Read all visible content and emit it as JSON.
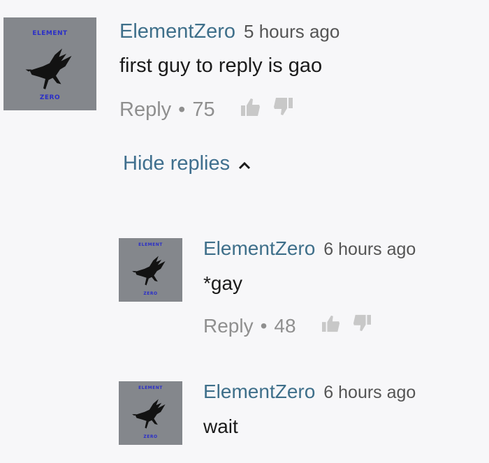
{
  "comment": {
    "avatar": {
      "top_text": "ELEMENT",
      "bottom_text": "ZERO",
      "icon": "crow-icon"
    },
    "author": "ElementZero",
    "time": "5 hours ago",
    "text": "first guy to reply is gao",
    "reply_label": "Reply",
    "separator": "•",
    "likes": "75",
    "like_icon": "thumbs-up-icon",
    "dislike_icon": "thumbs-down-icon",
    "hide_replies_label": "Hide replies",
    "hide_replies_icon": "chevron-up-icon"
  },
  "replies": [
    {
      "avatar": {
        "top_text": "ELEMENT",
        "bottom_text": "ZERO",
        "icon": "crow-icon"
      },
      "author": "ElementZero",
      "time": "6 hours ago",
      "text": "*gay",
      "reply_label": "Reply",
      "separator": "•",
      "likes": "48"
    },
    {
      "avatar": {
        "top_text": "ELEMENT",
        "bottom_text": "ZERO",
        "icon": "crow-icon"
      },
      "author": "ElementZero",
      "time": "6 hours ago",
      "text": "wait"
    }
  ]
}
